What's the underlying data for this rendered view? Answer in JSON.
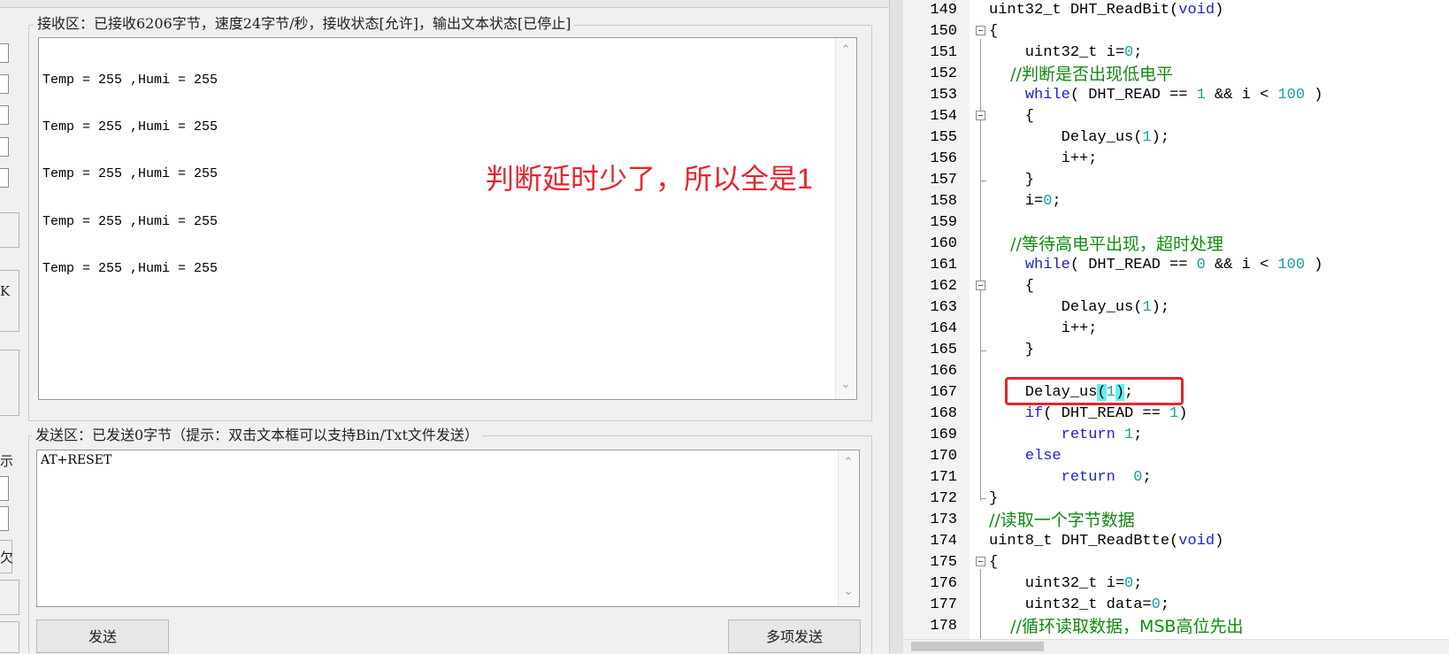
{
  "serial_tool": {
    "receive_group_title": "接收区：已接收6206字节，速度24字节/秒，接收状态[允许]，输出文本状态[已停止]",
    "receive_lines": [
      "Temp = 255 ,Humi = 255",
      "Temp = 255 ,Humi = 255",
      "Temp = 255 ,Humi = 255",
      "Temp = 255 ,Humi = 255",
      "Temp = 255 ,Humi = 255"
    ],
    "annotation_text": "判断延时少了，所以全是1",
    "send_group_title": "发送区：已发送0字节（提示：双击文本框可以支持Bin/Txt文件发送）",
    "send_text": "AT+RESET",
    "send_button": "发送",
    "multi_send_button": "多项发送",
    "left_edge_glyphs": [
      "K",
      "示",
      "欠"
    ]
  },
  "editor": {
    "lines": [
      {
        "n": "149",
        "code": "uint32_t DHT_ReadBit(void)"
      },
      {
        "n": "150",
        "code": "{"
      },
      {
        "n": "151",
        "code": "    uint32_t i=0;"
      },
      {
        "n": "152",
        "code": "    //判断是否出现低电平"
      },
      {
        "n": "153",
        "code": "    while( DHT_READ == 1 && i < 100 )"
      },
      {
        "n": "154",
        "code": "    {"
      },
      {
        "n": "155",
        "code": "        Delay_us(1);"
      },
      {
        "n": "156",
        "code": "        i++;"
      },
      {
        "n": "157",
        "code": "    }"
      },
      {
        "n": "158",
        "code": "    i=0;"
      },
      {
        "n": "159",
        "code": ""
      },
      {
        "n": "160",
        "code": "    //等待高电平出现，超时处理"
      },
      {
        "n": "161",
        "code": "    while( DHT_READ == 0 && i < 100 )"
      },
      {
        "n": "162",
        "code": "    {"
      },
      {
        "n": "163",
        "code": "        Delay_us(1);"
      },
      {
        "n": "164",
        "code": "        i++;"
      },
      {
        "n": "165",
        "code": "    }"
      },
      {
        "n": "166",
        "code": ""
      },
      {
        "n": "167",
        "code": "    Delay_us(1);"
      },
      {
        "n": "168",
        "code": "    if( DHT_READ == 1)"
      },
      {
        "n": "169",
        "code": "        return 1;"
      },
      {
        "n": "170",
        "code": "    else"
      },
      {
        "n": "171",
        "code": "        return  0;"
      },
      {
        "n": "172",
        "code": "}"
      },
      {
        "n": "173",
        "code": "//读取一个字节数据"
      },
      {
        "n": "174",
        "code": "uint8_t DHT_ReadBtte(void)"
      },
      {
        "n": "175",
        "code": "{"
      },
      {
        "n": "176",
        "code": "    uint32_t i=0;"
      },
      {
        "n": "177",
        "code": "    uint32_t data=0;"
      },
      {
        "n": "178",
        "code": "    //循环读取数据，MSB高位先出"
      }
    ]
  },
  "colors": {
    "keyword": "#1f1fcf",
    "number": "#1a9e9e",
    "comment": "#118a11",
    "annotation": "#e8242d",
    "bracket_highlight": "#5ff0f0"
  }
}
